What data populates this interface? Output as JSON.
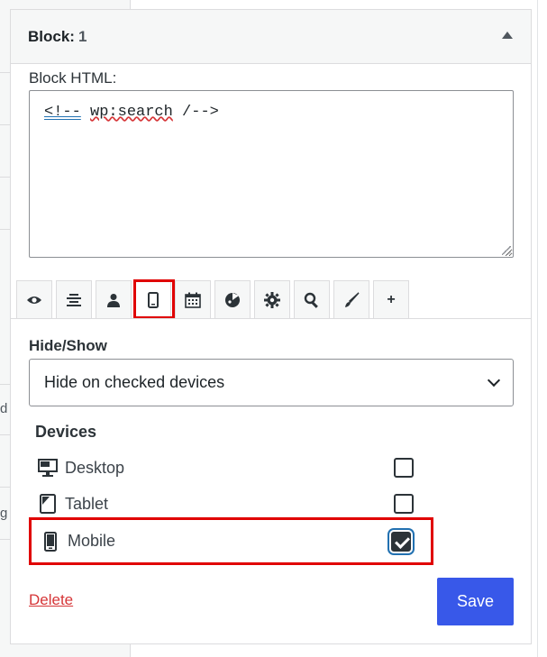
{
  "background": {
    "fragment_d": "d",
    "fragment_g": "g"
  },
  "panel": {
    "title": "Block:",
    "number": "1",
    "collapse_icon": "triangle-up-icon"
  },
  "html_field": {
    "label": "Block HTML:",
    "value": "<!-- wp:search /-->",
    "part1": "<!--",
    "part2": " ",
    "part3": "wp:search",
    "part4": " /-->"
  },
  "tabs": [
    {
      "icon": "eye-icon",
      "glyph": "👁"
    },
    {
      "icon": "align-center-icon",
      "glyph": "☰"
    },
    {
      "icon": "user-icon",
      "glyph": "👤"
    },
    {
      "icon": "mobile-icon",
      "glyph": "▯",
      "active": true
    },
    {
      "icon": "calendar-icon",
      "glyph": "📅"
    },
    {
      "icon": "palette-icon",
      "glyph": "◕"
    },
    {
      "icon": "gear-icon",
      "glyph": "⚙"
    },
    {
      "icon": "search-icon",
      "glyph": "🔍"
    },
    {
      "icon": "brush-icon",
      "glyph": "🖌"
    },
    {
      "icon": "plus-icon",
      "glyph": "+"
    }
  ],
  "visibility": {
    "label": "Hide/Show",
    "selected": "Hide on checked devices"
  },
  "devices": {
    "title": "Devices",
    "items": [
      {
        "label": "Desktop",
        "checked": false,
        "icon": "desktop-icon"
      },
      {
        "label": "Tablet",
        "checked": false,
        "icon": "tablet-icon"
      },
      {
        "label": "Mobile",
        "checked": true,
        "icon": "mobile-icon"
      }
    ]
  },
  "actions": {
    "delete_label": "Delete",
    "save_label": "Save"
  },
  "colors": {
    "primary": "#3858e9",
    "danger": "#d63638",
    "highlight": "#e00000"
  }
}
